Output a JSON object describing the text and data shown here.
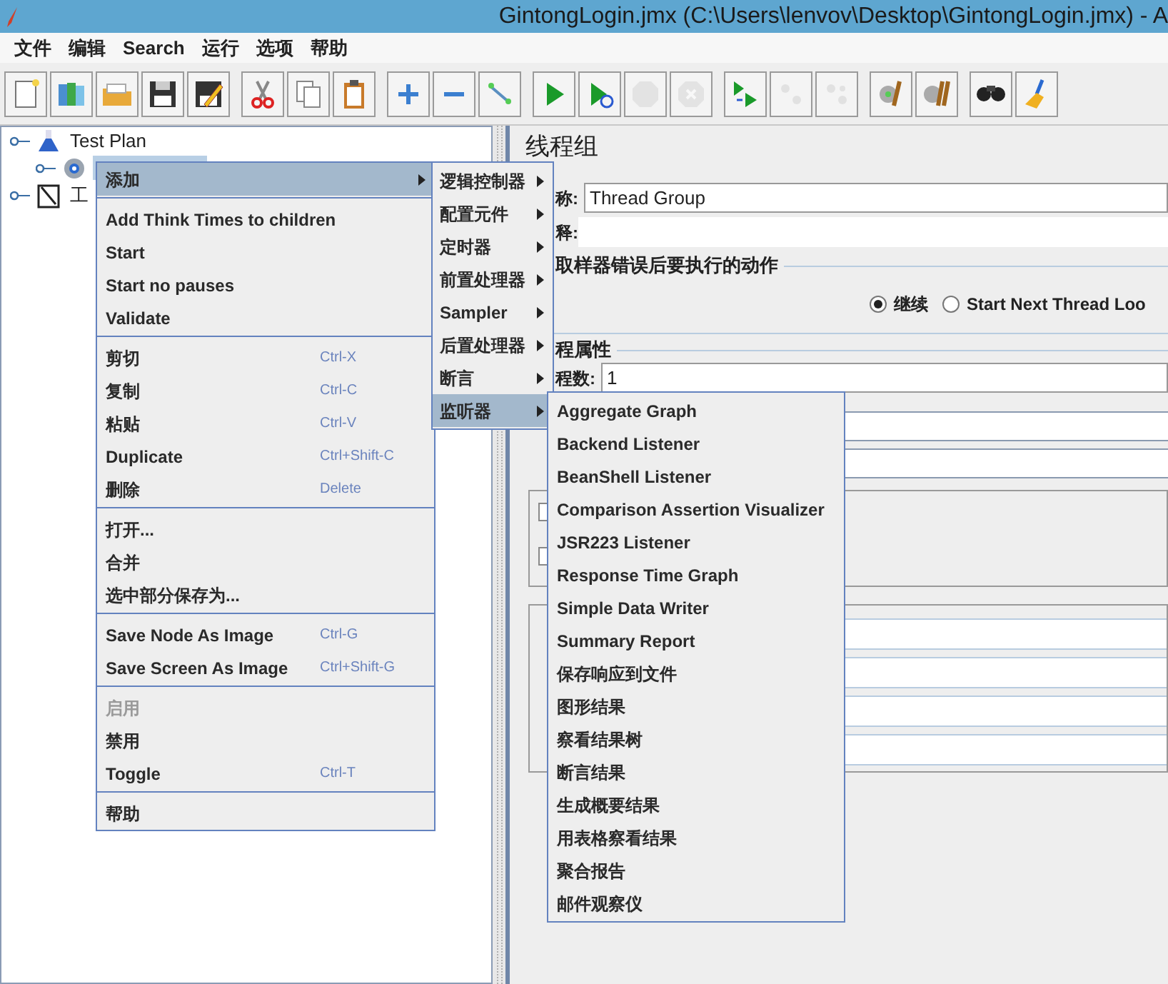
{
  "window": {
    "title": "GintongLogin.jmx (C:\\Users\\lenvov\\Desktop\\GintongLogin.jmx) - A"
  },
  "menu_bar": [
    {
      "label": "文件"
    },
    {
      "label": "编辑"
    },
    {
      "label": "Search"
    },
    {
      "label": "运行"
    },
    {
      "label": "选项"
    },
    {
      "label": "帮助"
    }
  ],
  "toolbar": [
    [
      {
        "disabled": false
      },
      {
        "disabled": false
      },
      {
        "disabled": false
      },
      {
        "disabled": false
      },
      {
        "disabled": false
      }
    ],
    [
      {
        "disabled": false
      },
      {
        "disabled": false
      },
      {
        "disabled": false
      }
    ],
    [
      {
        "disabled": false
      },
      {
        "disabled": false
      },
      {
        "disabled": false
      }
    ],
    [
      {
        "disabled": false
      },
      {
        "disabled": false
      },
      {
        "disabled": true
      },
      {
        "disabled": true
      }
    ],
    [
      {
        "disabled": false
      },
      {
        "disabled": true
      },
      {
        "disabled": true
      }
    ],
    [
      {
        "disabled": false
      },
      {
        "disabled": false
      }
    ],
    [
      {
        "disabled": false
      },
      {
        "disabled": false
      }
    ]
  ],
  "tree": [
    {
      "label": "Test Plan",
      "selected": false,
      "children": [
        {
          "selected": true
        }
      ]
    },
    {
      "label": "工",
      "selected": false
    }
  ],
  "context_menu": {
    "groups": [
      [
        {
          "label": "添加",
          "submenu": true,
          "selected": true
        }
      ],
      [
        {
          "label": "Add Think Times to children"
        },
        {
          "label": "Start"
        },
        {
          "label": "Start no pauses"
        },
        {
          "label": "Validate"
        }
      ],
      [
        {
          "label": "剪切",
          "shortcut": "Ctrl-X"
        },
        {
          "label": "复制",
          "shortcut": "Ctrl-C"
        },
        {
          "label": "粘贴",
          "shortcut": "Ctrl-V"
        },
        {
          "label": "Duplicate",
          "shortcut": "Ctrl+Shift-C"
        },
        {
          "label": "删除",
          "shortcut": "Delete"
        }
      ],
      [
        {
          "label": "打开..."
        },
        {
          "label": "合并"
        },
        {
          "label": "选中部分保存为..."
        }
      ],
      [
        {
          "label": "Save Node As Image",
          "shortcut": "Ctrl-G"
        },
        {
          "label": "Save Screen As Image",
          "shortcut": "Ctrl+Shift-G"
        }
      ],
      [
        {
          "label": "启用",
          "disabled": true
        },
        {
          "label": "禁用"
        },
        {
          "label": "Toggle",
          "shortcut": "Ctrl-T"
        }
      ],
      [
        {
          "label": "帮助"
        }
      ]
    ]
  },
  "add_submenu": [
    {
      "label": "逻辑控制器",
      "selected": false
    },
    {
      "label": "配置元件",
      "selected": false
    },
    {
      "label": "定时器",
      "selected": false
    },
    {
      "label": "前置处理器",
      "selected": false
    },
    {
      "label": "Sampler",
      "selected": false
    },
    {
      "label": "后置处理器",
      "selected": false
    },
    {
      "label": "断言",
      "selected": false
    },
    {
      "label": "监听器",
      "selected": true
    }
  ],
  "listener_submenu": [
    {
      "label": "Aggregate Graph"
    },
    {
      "label": "Backend Listener"
    },
    {
      "label": "BeanShell Listener"
    },
    {
      "label": "Comparison Assertion Visualizer"
    },
    {
      "label": "JSR223 Listener"
    },
    {
      "label": "Response Time Graph"
    },
    {
      "label": "Simple Data Writer"
    },
    {
      "label": "Summary Report"
    },
    {
      "label": "保存响应到文件"
    },
    {
      "label": "图形结果"
    },
    {
      "label": "察看结果树"
    },
    {
      "label": "断言结果"
    },
    {
      "label": "生成概要结果"
    },
    {
      "label": "用表格察看结果"
    },
    {
      "label": "聚合报告"
    },
    {
      "label": "邮件观察仪"
    }
  ],
  "panel": {
    "title": "线程组",
    "name_label": "称:",
    "name_value": "Thread Group",
    "comment_label": "释:",
    "error_action": {
      "legend": "取样器错误后要执行的动作",
      "options": [
        {
          "label": "继续",
          "selected": true
        },
        {
          "label": "Start Next Thread Loo",
          "selected": false
        }
      ]
    },
    "thread_props": {
      "legend": "程属性",
      "threads_label": "程数:",
      "threads_value": "1",
      "checkboxes": [
        {
          "checked": false
        },
        {
          "checked": false
        }
      ]
    }
  }
}
